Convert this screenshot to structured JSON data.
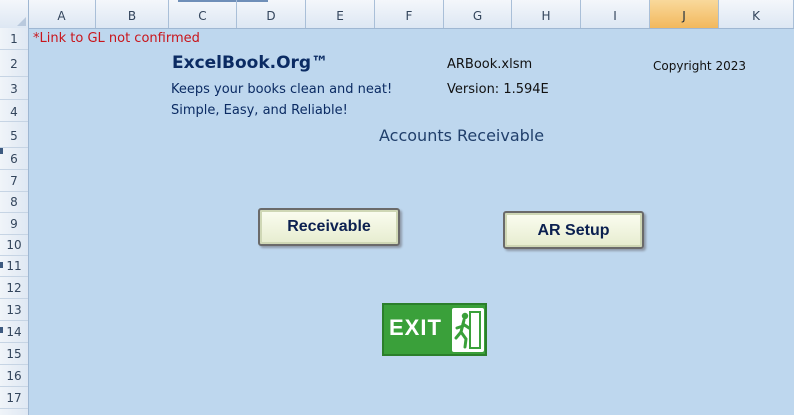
{
  "columns": [
    "A",
    "B",
    "C",
    "D",
    "E",
    "F",
    "G",
    "H",
    "I",
    "J",
    "K"
  ],
  "selected_column": "J",
  "rows": [
    "1",
    "2",
    "3",
    "4",
    "5",
    "6",
    "7",
    "8",
    "9",
    "10",
    "11",
    "12",
    "13",
    "14",
    "15",
    "16",
    "17"
  ],
  "sheet": {
    "note": "*Link to GL not confirmed",
    "brand": "ExcelBook.Org™",
    "tagline1": "Keeps your books clean and neat!",
    "tagline2": "Simple, Easy, and Reliable!",
    "filename": "ARBook.xlsm",
    "version": "Version: 1.594E",
    "copyright": "Copyright  2023",
    "title": "Accounts Receivable"
  },
  "buttons": {
    "receivable": "Receivable",
    "ar_setup": "AR Setup",
    "exit": "EXIT"
  },
  "colors": {
    "sheet_bg": "#bed7ee",
    "note_red": "#c9151b",
    "brand_navy": "#0b2b63",
    "exit_green": "#3aa03a"
  },
  "icons": {
    "exit_figure": "running-man-exit-icon"
  }
}
